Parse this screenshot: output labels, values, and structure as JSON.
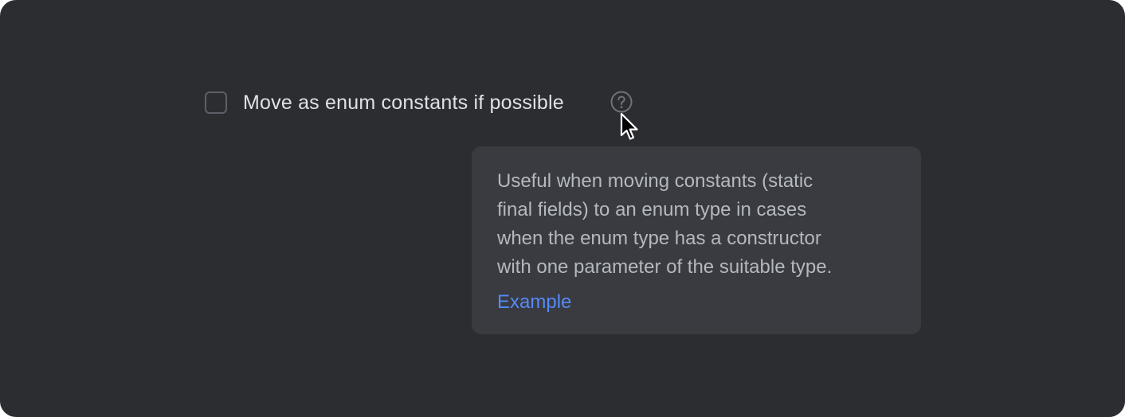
{
  "option": {
    "label": "Move as enum constants if possible",
    "checked": false
  },
  "help_icon": "question-circle-icon",
  "cursor_icon": "arrow-pointer-icon",
  "tooltip": {
    "lines": [
      "Useful when moving constants (static",
      "final fields) to an enum type in cases",
      "when the enum type has a constructor",
      "with one parameter of the suitable type."
    ],
    "link_label": "Example"
  },
  "colors": {
    "background": "#2b2d31",
    "tooltip_background": "#393b40",
    "label_text": "#dfe1e5",
    "tooltip_text": "#b4b8bf",
    "link": "#548af7",
    "checkbox_border": "#5d6066"
  }
}
